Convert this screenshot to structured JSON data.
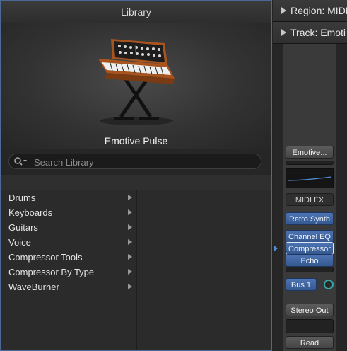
{
  "library": {
    "title": "Library",
    "patch_name": "Emotive Pulse",
    "search": {
      "placeholder": "Search Library"
    },
    "categories": [
      {
        "label": "Drums"
      },
      {
        "label": "Keyboards"
      },
      {
        "label": "Guitars"
      },
      {
        "label": "Voice"
      },
      {
        "label": "Compressor Tools"
      },
      {
        "label": "Compressor By Type"
      },
      {
        "label": "WaveBurner"
      }
    ]
  },
  "inspector": {
    "region_label": "Region: MIDI",
    "track_label": "Track: Emoti"
  },
  "channel_strip": {
    "setting_button": "Emotive...",
    "midi_fx": "MIDI FX",
    "instrument": "Retro Synth",
    "inserts": [
      "Channel EQ",
      "Compressor",
      "Echo"
    ],
    "send": "Bus 1",
    "output": "Stereo Out",
    "automation": "Read"
  },
  "colors": {
    "accent_blue": "#3e63a0",
    "panel_border": "#4c6a96",
    "send_knob": "#3ba6a6"
  }
}
